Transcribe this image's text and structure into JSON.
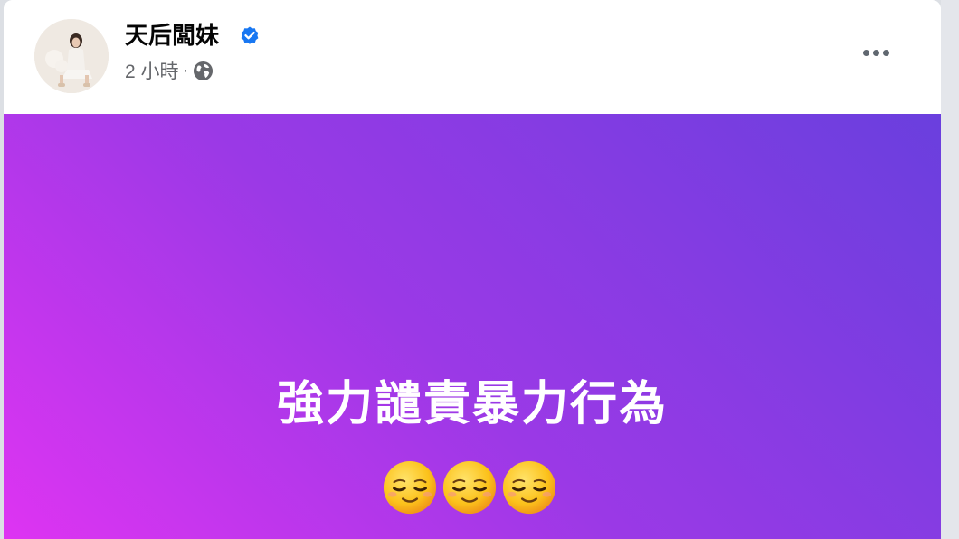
{
  "post": {
    "author": {
      "name": "天后闆妹",
      "verified": true,
      "avatar_icon": "avatar-photo"
    },
    "meta": {
      "time": "2 小時",
      "separator": "·",
      "privacy_icon": "globe-icon"
    },
    "menu_icon": "more-options-icon",
    "background": {
      "gradient_colors": [
        "#de34f2",
        "#9b39e6",
        "#6a3fde"
      ]
    },
    "text": "強力譴責暴力行為",
    "emojis": [
      "relieved-face",
      "relieved-face",
      "relieved-face"
    ]
  },
  "colors": {
    "verified_blue": "#1877f2",
    "name_text": "#050505",
    "meta_text": "#65676b",
    "post_text": "#ffffff"
  }
}
